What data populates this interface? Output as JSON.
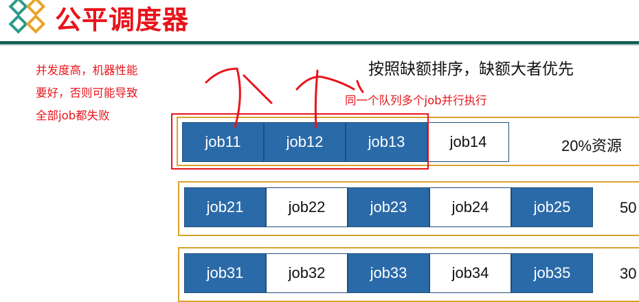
{
  "header": {
    "title": "公平调度器",
    "accent_color": "#e8141b",
    "line_color": "#0f5a55"
  },
  "notes": {
    "left_annotation": [
      "并发度高，机器性能",
      "要好，否则可能导致",
      "全部job都失败"
    ],
    "sort_rule": "按照缺额排序，缺额大者优先",
    "parallel_note": "同一个队列多个job并行执行"
  },
  "queues": [
    {
      "resource": "20%资源",
      "jobs": [
        {
          "label": "job11",
          "running": true
        },
        {
          "label": "job12",
          "running": true
        },
        {
          "label": "job13",
          "running": true
        },
        {
          "label": "job14",
          "running": false
        }
      ]
    },
    {
      "resource": "50",
      "jobs": [
        {
          "label": "job21",
          "running": true
        },
        {
          "label": "job22",
          "running": false
        },
        {
          "label": "job23",
          "running": true
        },
        {
          "label": "job24",
          "running": false
        },
        {
          "label": "job25",
          "running": true
        }
      ]
    },
    {
      "resource": "30",
      "jobs": [
        {
          "label": "job31",
          "running": true
        },
        {
          "label": "job32",
          "running": false
        },
        {
          "label": "job33",
          "running": true
        },
        {
          "label": "job34",
          "running": false
        },
        {
          "label": "job35",
          "running": true
        }
      ]
    }
  ],
  "colors": {
    "running_fill": "#2b6aa8",
    "queue_border": "#d9a22c",
    "highlight": "#e8141b"
  }
}
